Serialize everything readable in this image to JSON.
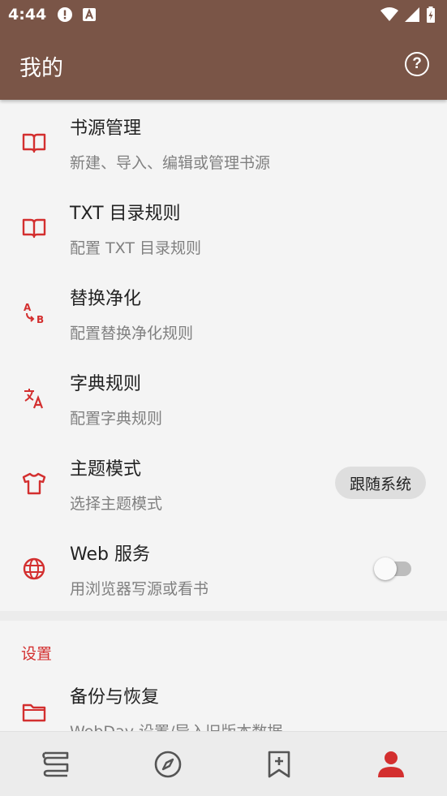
{
  "status_bar": {
    "time": "4:44"
  },
  "app_bar": {
    "title": "我的",
    "help_icon": "help-circle-icon"
  },
  "colors": {
    "app_bar": "#7a5547",
    "accent": "#d32f2f",
    "background": "#f4f4f4"
  },
  "items": [
    {
      "title": "书源管理",
      "summary": "新建、导入、编辑或管理书源",
      "icon": "book-open-icon"
    },
    {
      "title": "TXT 目录规则",
      "summary": "配置 TXT 目录规则",
      "icon": "book-open-icon"
    },
    {
      "title": "替换净化",
      "summary": "配置替换净化规则",
      "icon": "replace-ab-icon"
    },
    {
      "title": "字典规则",
      "summary": "配置字典规则",
      "icon": "translate-icon"
    },
    {
      "title": "主题模式",
      "summary": "选择主题模式",
      "icon": "tshirt-icon",
      "value": "跟随系统"
    },
    {
      "title": "Web 服务",
      "summary": "用浏览器写源或看书",
      "icon": "globe-icon",
      "switch_on": false
    }
  ],
  "settings": {
    "category": "设置",
    "items": [
      {
        "title": "备份与恢复",
        "summary": "WebDav 设置/导入旧版本数据",
        "icon": "folder-icon"
      }
    ]
  },
  "bottom_nav": [
    {
      "name": "bookshelf",
      "icon": "bookshelf-icon",
      "active": false
    },
    {
      "name": "explore",
      "icon": "compass-icon",
      "active": false
    },
    {
      "name": "rss",
      "icon": "bookmark-add-icon",
      "active": false
    },
    {
      "name": "my",
      "icon": "person-icon",
      "active": true
    }
  ]
}
